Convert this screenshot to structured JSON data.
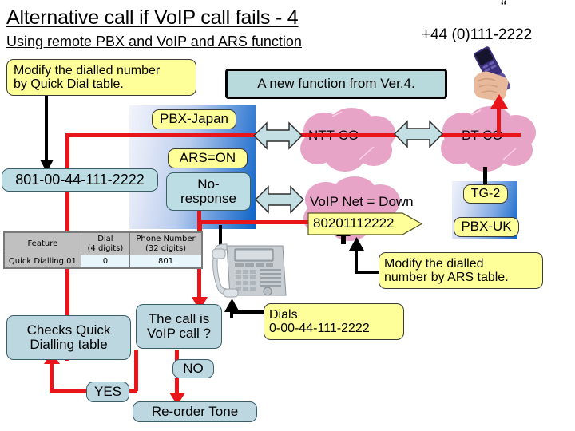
{
  "slide": {
    "title": "Alternative call if VoIP call fails - 4",
    "subtitle": "Using remote PBX and VoIP and ARS function",
    "quote_mark": "“",
    "remote_number": "+44 (0)111-2222"
  },
  "callouts": {
    "modify_quick_dial": "Modify the dialled number by Quick Dial table.",
    "modify_quick_dial_line1": "Modify the dialled number",
    "modify_quick_dial_line2": "by Quick Dial table.",
    "new_function": "A new function from Ver.4.",
    "modify_ars_line1": "Modify the dialled",
    "modify_ars_line2": "number by ARS table.",
    "dials_line1": "Dials",
    "dials_line2": "0-00-44-111-2222"
  },
  "nodes": {
    "pbx_japan": "PBX-Japan",
    "ars_on": "ARS=ON",
    "no_response_line1": "No-",
    "no_response_line2": "response",
    "dialled_number": "801-00-44-111-2222",
    "tg2": "TG-2",
    "pbx_uk": "PBX-UK",
    "voip_number": "80201112222"
  },
  "clouds": [
    {
      "label": "NTT-CO",
      "color": "#e8a6c9"
    },
    {
      "label": "BT CO",
      "color": "#e8a6c9"
    },
    {
      "label": "VoIP Net = Down",
      "color": "#e8a6c9"
    }
  ],
  "flow": {
    "checks_line1": "Checks Quick",
    "checks_line2": "Dialling table",
    "decision_line1": "The call is",
    "decision_line2": "VoIP call ?",
    "yes": "YES",
    "no": "NO",
    "reorder": "Re-order Tone"
  },
  "table": {
    "headers": [
      {
        "line1": "Feature",
        "line2": ""
      },
      {
        "line1": "Dial",
        "line2": "(4 digits)"
      },
      {
        "line1": "Phone Number",
        "line2": "(32 digits)"
      }
    ],
    "rows": [
      {
        "feature": "Quick Dialling 01",
        "dial": "0",
        "number": "801"
      }
    ]
  },
  "colors": {
    "red_line": "#e8151b",
    "yellow_callout": "#ffff99",
    "blue_callout": "#bcdde3",
    "cloud_pink": "#e8a6c9",
    "arrow_fill": "#c3dfe3",
    "pbx_blue": "#0b63c6"
  },
  "icons": {
    "mobile_phone": "mobile-phone-in-hand",
    "desk_phone": "desk-telephone",
    "double_arrow": "double-headed-arrow"
  }
}
